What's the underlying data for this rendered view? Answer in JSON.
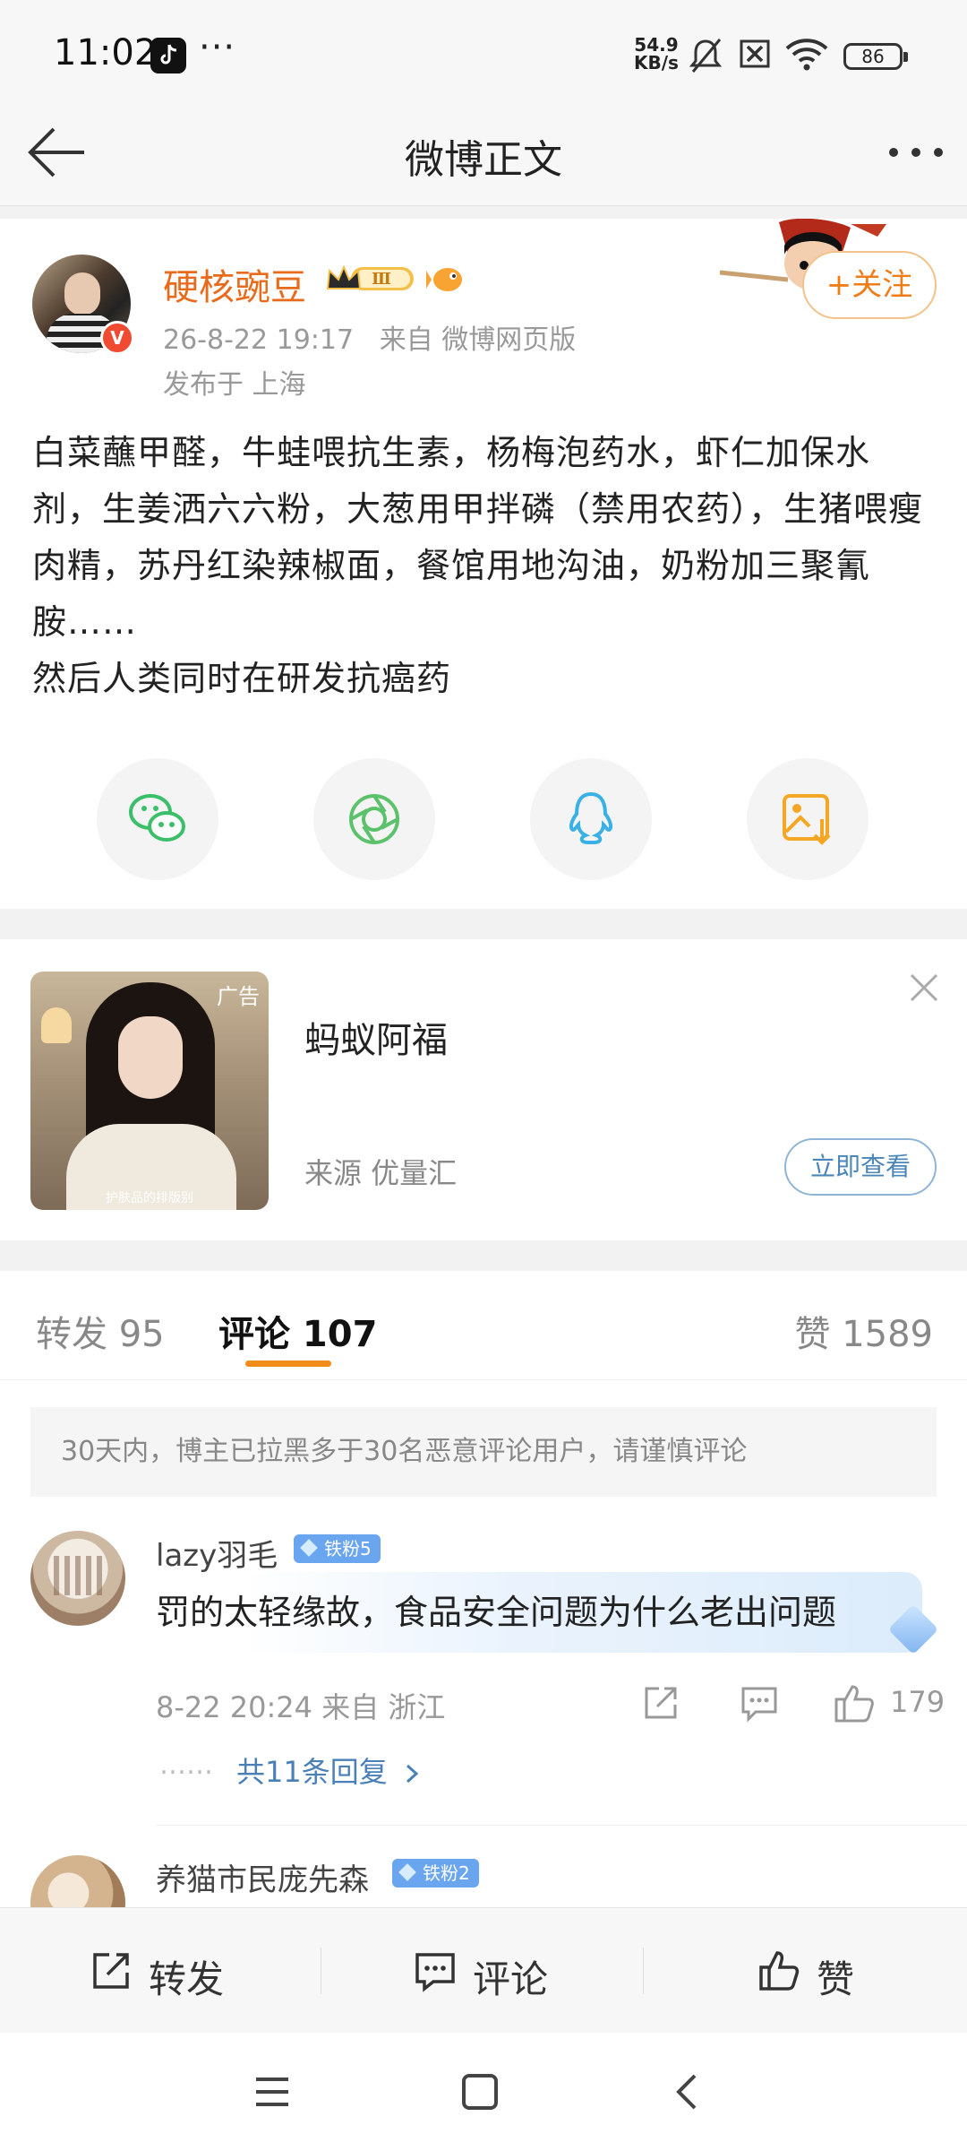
{
  "status_bar": {
    "time": "11:02",
    "dots": "···",
    "net_speed_value": "54.9",
    "net_speed_unit": "KB/s",
    "battery": "86",
    "icons": [
      "tiktok-icon",
      "mute-icon",
      "sim-blocked-icon",
      "wifi-icon",
      "battery-icon"
    ]
  },
  "header": {
    "title": "微博正文",
    "back_icon": "arrow-left-icon",
    "more_icon": "more-dots-icon"
  },
  "post": {
    "username": "硬核豌豆",
    "level_badge": "Ⅲ",
    "verified_badge": "V",
    "datetime": "26-8-22 19:17",
    "source": "来自 微博网页版",
    "location": "发布于 上海",
    "follow_label": "+关注",
    "text_lines": [
      "白菜蘸甲醛，牛蛙喂抗生素，杨梅泡药水，虾仁加保水剂，生姜洒六六粉，大葱用甲拌磷（禁用农药），生猪喂瘦肉精，苏丹红染辣椒面，餐馆用地沟油，奶粉加三聚氰胺……",
      "然后人类同时在研发抗癌药"
    ],
    "share_targets": [
      "wechat-icon",
      "moments-icon",
      "qq-icon",
      "save-image-icon"
    ]
  },
  "ad": {
    "tag": "广告",
    "title": "蚂蚁阿福",
    "source": "来源 优量汇",
    "cta": "立即查看",
    "image_caption": "护肤品的排版别"
  },
  "comments_section": {
    "tabs": [
      {
        "label": "转发 95"
      },
      {
        "label": "评论 107"
      },
      {
        "label": "赞 1589"
      }
    ],
    "active_tab": "评论 107",
    "notice": "30天内，博主已拉黑多于30名恶意评论用户，请谨慎评论",
    "comments": [
      {
        "name": "lazy羽毛",
        "fan_badge": "铁粉5",
        "text": "罚的太轻缘故，食品安全问题为什么老出问题",
        "meta": "8-22 20:24  来自 浙江",
        "likes": "179",
        "replies_label": "共11条回复",
        "replies_dots": "……"
      },
      {
        "name": "养猫市民庞先森",
        "fan_badge": "铁粉2"
      }
    ]
  },
  "action_bar": {
    "repost": "转发",
    "comment": "评论",
    "like": "赞"
  },
  "colors": {
    "accent_orange": "#ef7d1a",
    "username_orange": "#e86b1c",
    "link_blue": "#4a7fb8",
    "fan_badge_blue": "#6aa5ef"
  }
}
